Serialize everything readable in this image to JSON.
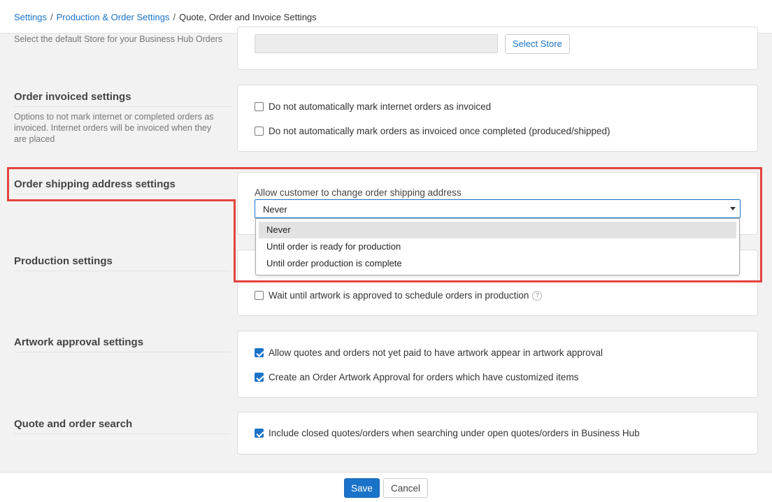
{
  "breadcrumb": {
    "items": [
      "Settings",
      "Production & Order Settings"
    ],
    "separator": "/",
    "current": "Quote, Order and Invoice Settings"
  },
  "store_section": {
    "description": "Select the default Store for your Business Hub Orders",
    "input_value": "",
    "button_label": "Select Store"
  },
  "invoiced_section": {
    "title": "Order invoiced settings",
    "description": "Options to not mark internet or completed orders as invoiced. Internet orders will be invoiced when they are placed",
    "options": [
      {
        "label": "Do not automatically mark internet orders as invoiced",
        "checked": false
      },
      {
        "label": "Do not automatically mark orders as invoiced once completed (produced/shipped)",
        "checked": false
      }
    ]
  },
  "shipping_section": {
    "title": "Order shipping address settings",
    "field_label": "Allow customer to change order shipping address",
    "selected_value": "Never",
    "dropdown_options": [
      "Never",
      "Until order is ready for production",
      "Until order production is complete"
    ]
  },
  "production_section": {
    "title": "Production settings",
    "option": {
      "label": "Wait until artwork is approved to schedule orders in production",
      "checked": false
    }
  },
  "artwork_section": {
    "title": "Artwork approval settings",
    "options": [
      {
        "label": "Allow quotes and orders not yet paid to have artwork appear in artwork approval",
        "checked": true
      },
      {
        "label": "Create an Order Artwork Approval for orders which have customized items",
        "checked": true
      }
    ]
  },
  "search_section": {
    "title": "Quote and order search",
    "option": {
      "label": "Include closed quotes/orders when searching under open quotes/orders in Business Hub",
      "checked": true
    }
  },
  "footer": {
    "save_label": "Save",
    "cancel_label": "Cancel"
  },
  "colors": {
    "accent": "#1a73c8",
    "highlight": "#e4433f",
    "background": "#f2f2f2"
  }
}
